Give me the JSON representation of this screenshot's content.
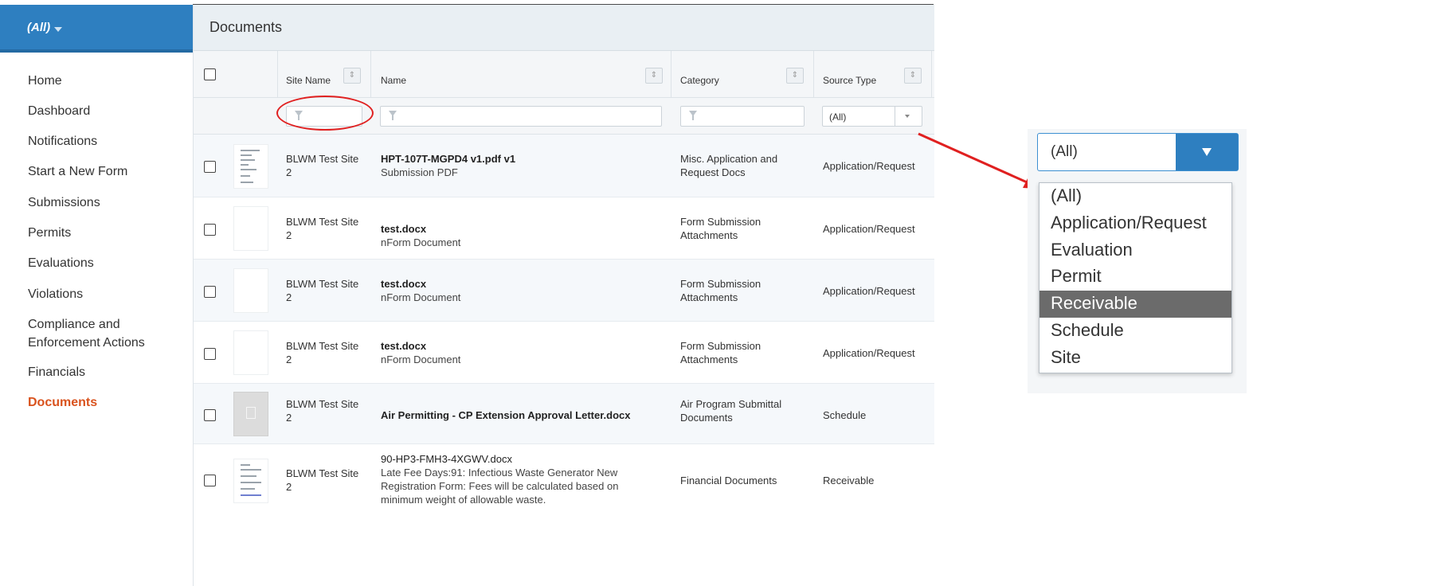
{
  "sidebar": {
    "context_label": "(All)",
    "items": [
      {
        "label": "Home"
      },
      {
        "label": "Dashboard"
      },
      {
        "label": "Notifications"
      },
      {
        "label": "Start a New Form"
      },
      {
        "label": "Submissions"
      },
      {
        "label": "Permits"
      },
      {
        "label": "Evaluations"
      },
      {
        "label": "Violations"
      },
      {
        "label": "Compliance and Enforcement Actions"
      },
      {
        "label": "Financials"
      },
      {
        "label": "Documents",
        "active": true
      }
    ]
  },
  "main": {
    "title": "Documents",
    "columns": {
      "site_name": "Site Name",
      "name": "Name",
      "category": "Category",
      "source_type": "Source Type"
    },
    "filters": {
      "source_type_selected": "(All)"
    },
    "rows": [
      {
        "site": "BLWM Test Site 2",
        "name": "HPT-107T-MGPD4 v1.pdf v1",
        "subtitle": "Submission PDF",
        "category": "Misc. Application and Request Docs",
        "source_type": "Application/Request",
        "thumb": "document-preview"
      },
      {
        "site": "BLWM Test Site 2",
        "name": "test.docx",
        "subtitle": "nForm Document",
        "category": "Form Submission Attachments",
        "source_type": "Application/Request",
        "thumb": "blank-page"
      },
      {
        "site": "BLWM Test Site 2",
        "name": "test.docx",
        "subtitle": "nForm Document",
        "category": "Form Submission Attachments",
        "source_type": "Application/Request",
        "thumb": "blank-page"
      },
      {
        "site": "BLWM Test Site 2",
        "name": "test.docx",
        "subtitle": "nForm Document",
        "category": "Form Submission Attachments",
        "source_type": "Application/Request",
        "thumb": "blank-page"
      },
      {
        "site": "BLWM Test Site 2",
        "name": "Air Permitting - CP Extension Approval Letter.docx",
        "subtitle": "",
        "category": "Air Program Submittal Documents",
        "source_type": "Schedule",
        "thumb": "file-icon"
      },
      {
        "site": "BLWM Test Site 2",
        "name": "90-HP3-FMH3-4XGWV.docx",
        "subtitle": "Late Fee Days:91: Infectious Waste Generator New Registration Form: Fees will be calculated based on minimum weight of allowable waste.",
        "category": "Financial Documents",
        "source_type": "Receivable",
        "thumb": "document-preview"
      }
    ]
  },
  "callout": {
    "selected_value": "(All)",
    "options": [
      "(All)",
      "Application/Request",
      "Evaluation",
      "Permit",
      "Receivable",
      "Schedule",
      "Site"
    ],
    "highlighted": "Receivable"
  },
  "colors": {
    "sidebar_header": "#2e7fc0",
    "active_nav": "#d9531e",
    "annotation": "#e02020",
    "highlight_option": "#6b6b6b"
  }
}
